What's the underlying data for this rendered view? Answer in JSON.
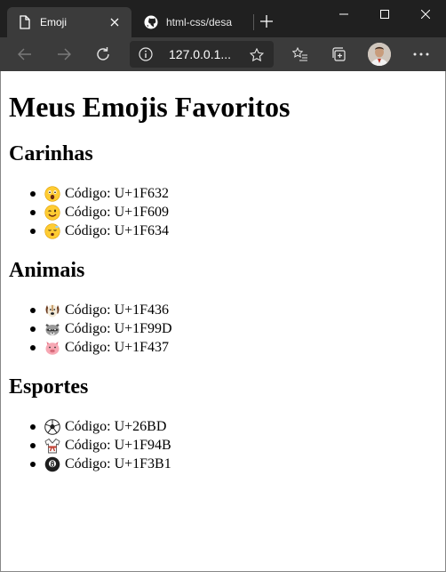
{
  "browser": {
    "tabs": [
      {
        "title": "Emoji",
        "active": true,
        "icon": "document-icon"
      },
      {
        "title": "html-css/desa",
        "active": false,
        "icon": "github-icon"
      }
    ],
    "address_url": "127.0.0.1...",
    "colors": {
      "tabbar": "#202020",
      "toolbar": "#3b3b3b",
      "address": "#2b2b2b"
    }
  },
  "page": {
    "title": "Meus Emojis Favoritos",
    "sections": [
      {
        "heading": "Carinhas",
        "items": [
          {
            "emoji": "astonished-face",
            "label": "Código:",
            "code": "U+1F632"
          },
          {
            "emoji": "winking-face",
            "label": "Código:",
            "code": "U+1F609"
          },
          {
            "emoji": "sleeping-face",
            "label": "Código:",
            "code": "U+1F634"
          }
        ]
      },
      {
        "heading": "Animais",
        "items": [
          {
            "emoji": "dog-face",
            "label": "Código:",
            "code": "U+1F436"
          },
          {
            "emoji": "raccoon",
            "label": "Código:",
            "code": "U+1F99D"
          },
          {
            "emoji": "pig-face",
            "label": "Código:",
            "code": "U+1F437"
          }
        ]
      },
      {
        "heading": "Esportes",
        "items": [
          {
            "emoji": "soccer-ball",
            "label": "Código:",
            "code": "U+26BD"
          },
          {
            "emoji": "martial-arts-uniform",
            "label": "Código:",
            "code": "U+1F94B"
          },
          {
            "emoji": "pool-8-ball",
            "label": "Código:",
            "code": "U+1F3B1"
          }
        ]
      }
    ]
  }
}
